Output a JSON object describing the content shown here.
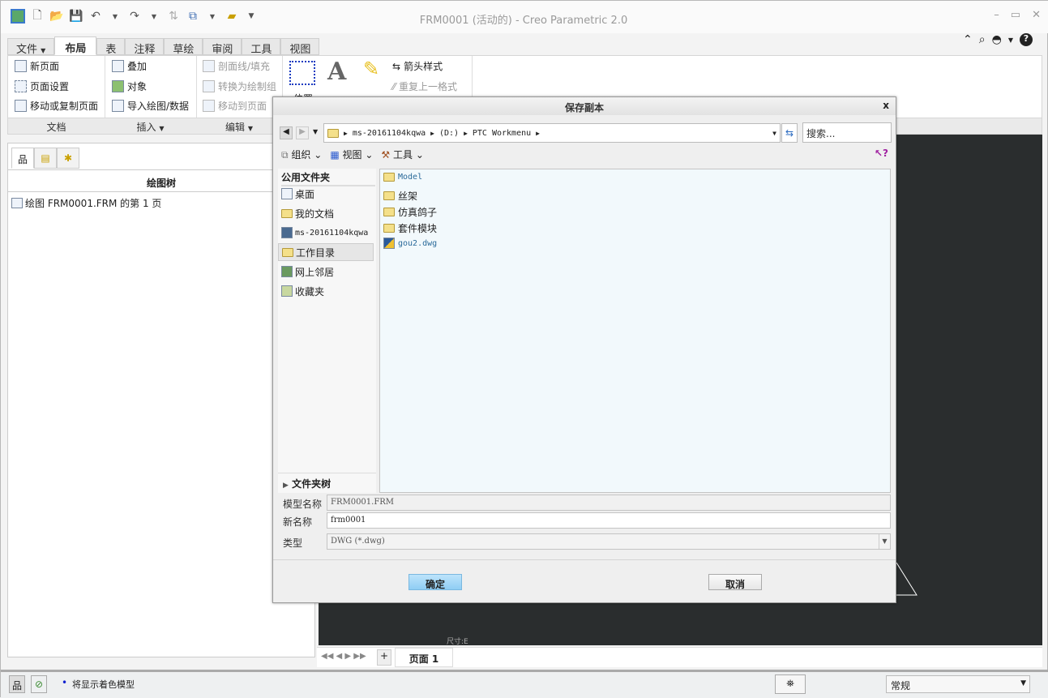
{
  "window": {
    "title": "FRM0001 (活动的) - Creo Parametric 2.0",
    "controls": [
      "minimize",
      "restore",
      "close"
    ]
  },
  "ribbon": {
    "tabs": [
      "文件",
      "布局",
      "表",
      "注释",
      "草绘",
      "审阅",
      "工具",
      "视图"
    ],
    "active_tab": "布局",
    "document": {
      "items": [
        "新页面",
        "页面设置",
        "移动或复制页面"
      ],
      "label": "文档"
    },
    "insert": {
      "items": [
        "叠加",
        "对象",
        "导入绘图/数据"
      ],
      "label": "插入"
    },
    "edit": {
      "items": [
        "剖面线/填充",
        "转换为绘制组",
        "移动到页面"
      ],
      "label": "编辑"
    },
    "position_label": "位置",
    "format": {
      "items": [
        "箭头样式",
        "重复上一格式"
      ]
    }
  },
  "left_panel": {
    "header": "绘图树",
    "tree_item": "绘图 FRM0001.FRM 的第 1 页"
  },
  "graphics": {
    "annotation": "尺寸:E"
  },
  "page_bar": {
    "add": "+",
    "page_tab": "页面 1"
  },
  "status_bar": {
    "message": "将显示着色模型",
    "filter": "常规"
  },
  "dialog": {
    "title": "保存副本",
    "close": "x",
    "path": [
      "ms-20161104kqwa",
      "(D:)",
      "PTC Workmenu"
    ],
    "search_placeholder": "搜索...",
    "toolbar": {
      "organize": "组织",
      "view": "视图",
      "tools": "工具"
    },
    "common_folders_header": "公用文件夹",
    "nav": [
      "桌面",
      "我的文档",
      "ms-20161104kqwa",
      "工作目录",
      "网上邻居",
      "收藏夹"
    ],
    "selected_nav": "工作目录",
    "folder_tree": "文件夹树",
    "files": [
      {
        "name": "Model",
        "type": "folder"
      },
      {
        "name": "丝架",
        "type": "folder"
      },
      {
        "name": "仿真鸽子",
        "type": "folder"
      },
      {
        "name": "套件模块",
        "type": "folder"
      },
      {
        "name": "gou2.dwg",
        "type": "dwg"
      }
    ],
    "model_name_label": "模型名称",
    "model_name": "FRM0001.FRM",
    "new_name_label": "新名称",
    "new_name": "frm0001",
    "type_label": "类型",
    "type": "DWG (*.dwg)",
    "ok": "确定",
    "cancel": "取消"
  }
}
